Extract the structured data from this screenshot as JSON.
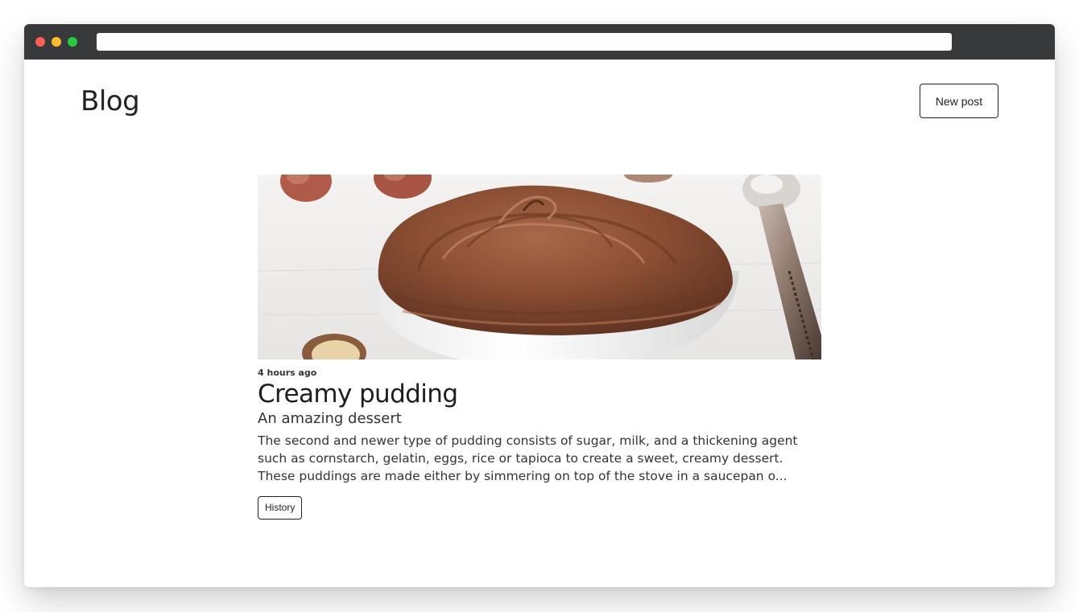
{
  "header": {
    "title": "Blog",
    "new_post_label": "New post"
  },
  "posts": [
    {
      "image": "chocolate-pudding-bowl",
      "time": "4 hours ago",
      "title": "Creamy pudding",
      "subtitle": "An amazing dessert",
      "excerpt": "The second and newer type of pudding consists of sugar, milk, and a thickening agent such as cornstarch, gelatin, eggs, rice or tapioca to create a sweet, creamy dessert. These puddings are made either by simmering on top of the stove in a saucepan o...",
      "tags": [
        "History"
      ]
    }
  ],
  "colors": {
    "titlebar": "#38393b",
    "close": "#fd5f57",
    "minimize": "#febb2e",
    "maximize": "#29c940",
    "text": "#222222"
  }
}
